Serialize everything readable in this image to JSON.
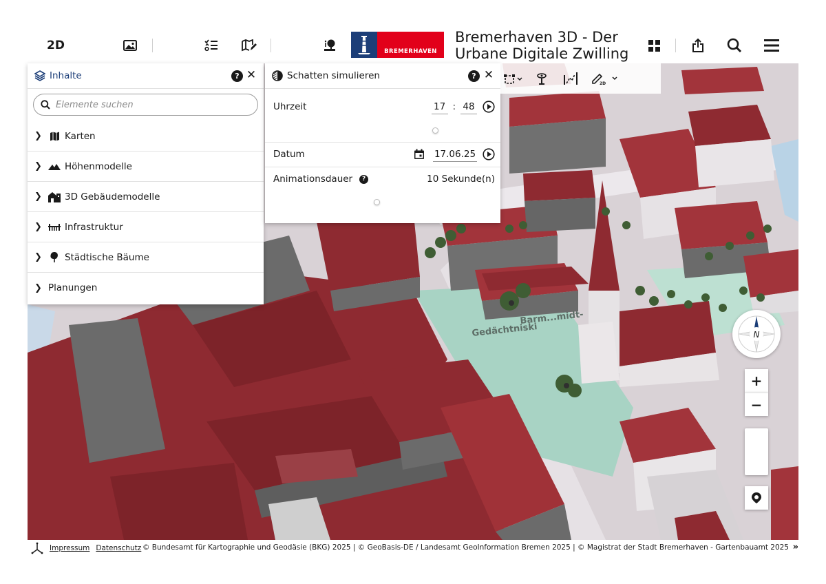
{
  "header": {
    "mode_label": "2D",
    "title": "Bremerhaven 3D - Der Urbane Digitale Zwilling",
    "logo_text": "BREMERHAVEN",
    "icons": [
      "image-icon",
      "layer-list-icon",
      "map-edit-icon",
      "tree-info-icon",
      "grid-menu-icon",
      "share-icon",
      "search-icon",
      "hamburger-menu-icon"
    ]
  },
  "inhalte": {
    "title": "Inhalte",
    "help": "?",
    "close": "✕",
    "search_placeholder": "Elemente suchen",
    "items": [
      {
        "label": "Karten",
        "icon": "map-icon"
      },
      {
        "label": "Höhenmodelle",
        "icon": "mountain-icon"
      },
      {
        "label": "3D Gebäudemodelle",
        "icon": "building-icon"
      },
      {
        "label": "Infrastruktur",
        "icon": "bridge-icon"
      },
      {
        "label": "Städtische Bäume",
        "icon": "tree-icon"
      },
      {
        "label": "Planungen",
        "icon": ""
      }
    ]
  },
  "schatten": {
    "title": "Schatten simulieren",
    "help": "?",
    "close": "✕",
    "time_label": "Uhrzeit",
    "hour": "17",
    "separator": ":",
    "minute": "48",
    "date_label": "Datum",
    "date": "17.06.25",
    "duration_label": "Animationsdauer",
    "duration_help": "?",
    "duration_value": "10 Sekunde(n)"
  },
  "map_controls": {
    "compass_label": "N",
    "zoom_in": "+",
    "zoom_out": "−"
  },
  "map": {
    "labels": [
      "Barm...midt-",
      "Gedächtniski"
    ],
    "colors": {
      "roof": "#8e2a31",
      "wall": "#6b6b6b",
      "ground": "#d9d2d6",
      "park": "#a8d3c4",
      "tree": "#3f5d34"
    }
  },
  "footer": {
    "impressum": "Impressum",
    "datenschutz": "Datenschutz",
    "attribution": "© Bundesamt für Kartographie und Geodäsie (BKG) 2025 | © GeoBasis-DE / Landesamt GeoInformation Bremen 2025 | © Magistrat der Stadt Bremerhaven - Gartenbauamt 2025",
    "expand": "»"
  }
}
